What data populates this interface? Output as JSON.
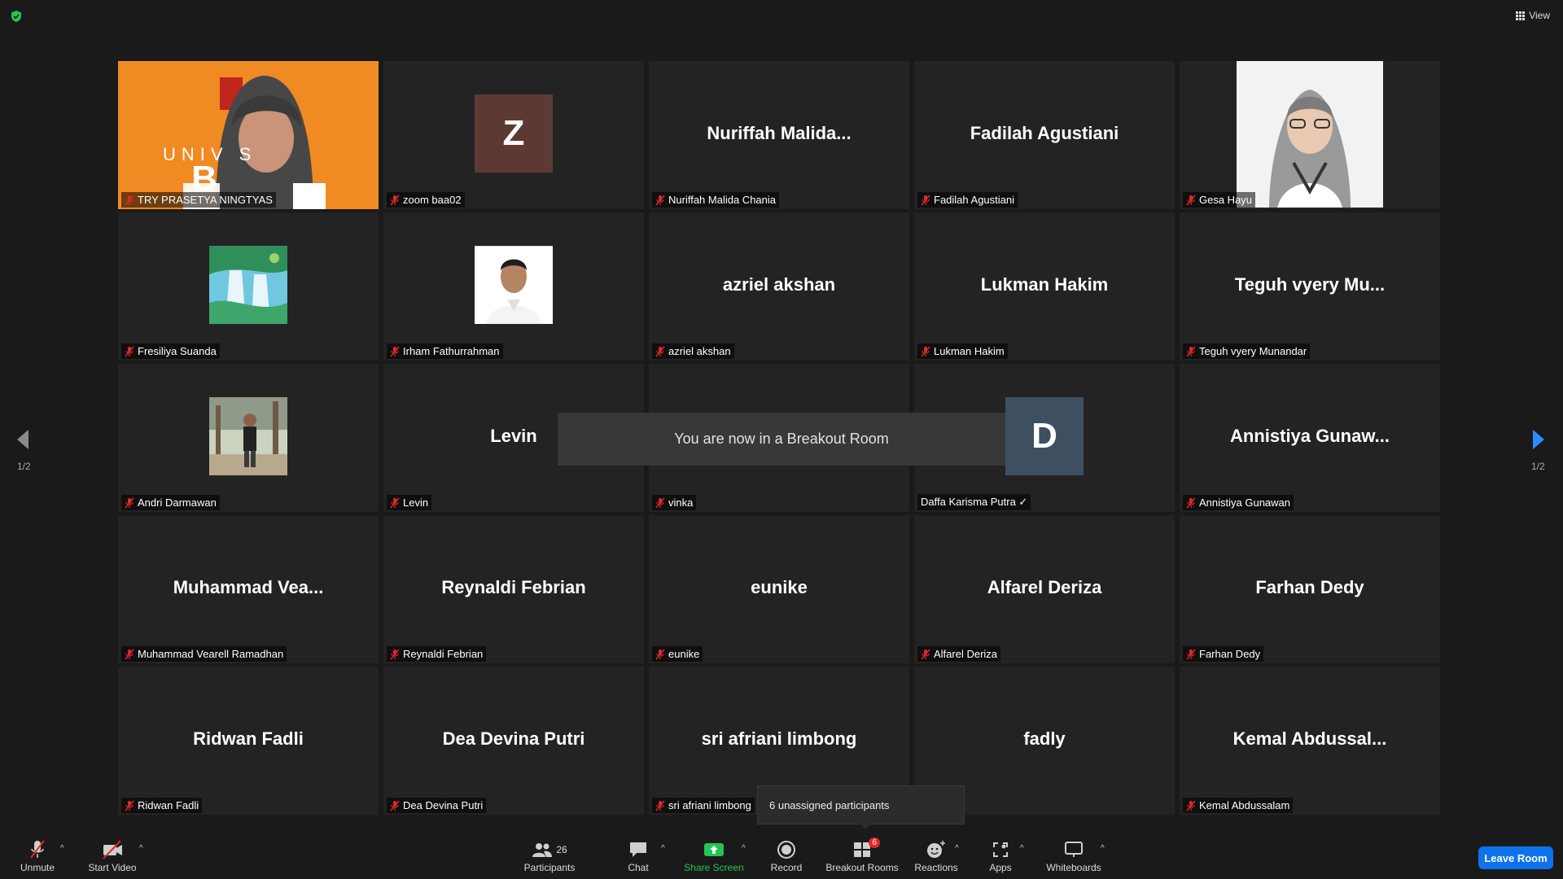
{
  "topbar": {
    "view_label": "View"
  },
  "tiles": [
    {
      "label": "TRY PRASETYA NINGTYAS",
      "kind": "video"
    },
    {
      "label": "zoom baa02",
      "kind": "letter",
      "letter": "Z",
      "color": "#5c3a33"
    },
    {
      "label": "Nuriffah Malida Chania",
      "kind": "name",
      "bigname": "Nuriffah  Malida..."
    },
    {
      "label": "Fadilah Agustiani",
      "kind": "name",
      "bigname": "Fadilah Agustiani"
    },
    {
      "label": "Gesa Hayu",
      "kind": "photo-hijab"
    },
    {
      "label": "Fresiliya Suanda",
      "kind": "photo-waterfall"
    },
    {
      "label": "Irham Fathurrahman",
      "kind": "photo-man"
    },
    {
      "label": "azriel akshan",
      "kind": "name",
      "bigname": "azriel akshan"
    },
    {
      "label": "Lukman Hakim",
      "kind": "name",
      "bigname": "Lukman Hakim"
    },
    {
      "label": "Teguh vyery Munandar",
      "kind": "name",
      "bigname": "Teguh  vyery  Mu..."
    },
    {
      "label": "Andri Darmawan",
      "kind": "photo-outdoor"
    },
    {
      "label": "Levin",
      "kind": "name",
      "bigname": "Levin"
    },
    {
      "label": "vinka",
      "kind": "name",
      "bigname": ""
    },
    {
      "label": "Daffa Karisma Putra ✓",
      "kind": "letter",
      "letter": "D",
      "color": "#3e5060",
      "unmuted": true
    },
    {
      "label": "Annistiya Gunawan",
      "kind": "name",
      "bigname": "Annistiya  Gunaw..."
    },
    {
      "label": "Muhammad Vearell Ramadhan",
      "kind": "name",
      "bigname": "Muhammad  Vea..."
    },
    {
      "label": "Reynaldi Febrian",
      "kind": "name",
      "bigname": "Reynaldi Febrian"
    },
    {
      "label": "eunike",
      "kind": "name",
      "bigname": "eunike"
    },
    {
      "label": "Alfarel Deriza",
      "kind": "name",
      "bigname": "Alfarel Deriza"
    },
    {
      "label": "Farhan Dedy",
      "kind": "name",
      "bigname": "Farhan Dedy"
    },
    {
      "label": "Ridwan Fadli",
      "kind": "name",
      "bigname": "Ridwan Fadli"
    },
    {
      "label": "Dea Devina Putri",
      "kind": "name",
      "bigname": "Dea Devina Putri"
    },
    {
      "label": "sri afriani limbong",
      "kind": "name",
      "bigname": "sri afriani limbong"
    },
    {
      "label": "",
      "kind": "name",
      "bigname": "fadly"
    },
    {
      "label": "Kemal Abdussalam",
      "kind": "name",
      "bigname": "Kemal  Abdussal..."
    }
  ],
  "video_overlay_text": {
    "line1": "UNIV   S",
    "line2": "B"
  },
  "nav": {
    "left_page": "1/2",
    "right_page": "1/2"
  },
  "toast": "You are now in a Breakout Room",
  "tooltip": "6 unassigned participants",
  "toolbar": {
    "unmute": "Unmute",
    "start_video": "Start Video",
    "participants": "Participants",
    "participants_count": "26",
    "chat": "Chat",
    "share_screen": "Share Screen",
    "record": "Record",
    "breakout_rooms": "Breakout Rooms",
    "breakout_badge": "6",
    "reactions": "Reactions",
    "apps": "Apps",
    "whiteboards": "Whiteboards",
    "leave": "Leave Room"
  },
  "colors": {
    "active_speaker": "#d9e62b",
    "share_green": "#23c552",
    "leave_blue": "#0e72ed",
    "badge_red": "#e02828"
  }
}
